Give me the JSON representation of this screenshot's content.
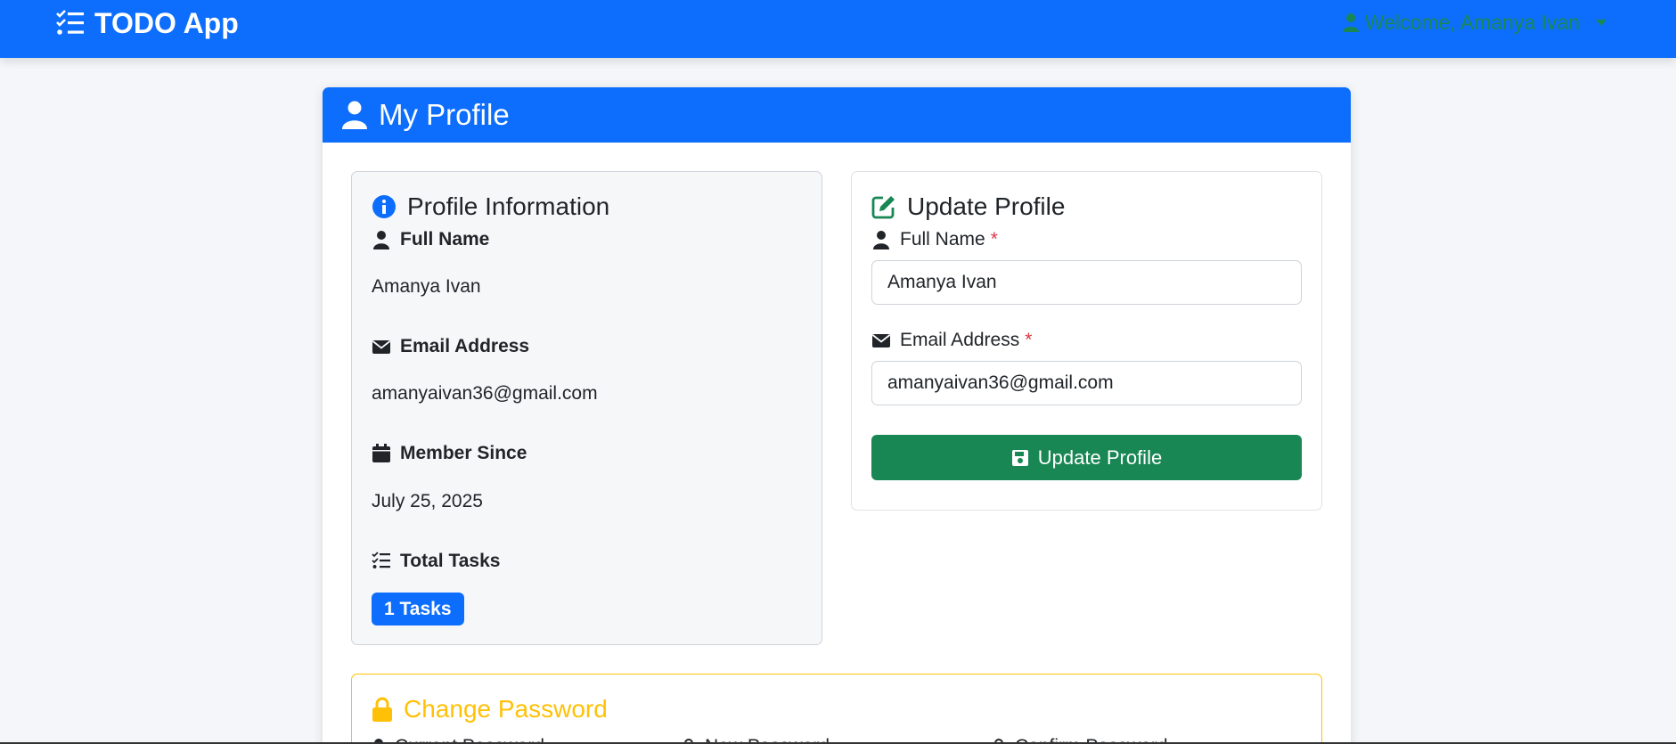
{
  "navbar": {
    "brand": "TODO App",
    "brand_icon": "tasks-list-icon",
    "user_greeting": "Welcome, Amanya Ivan",
    "user_icon": "user-icon"
  },
  "card": {
    "title": "My Profile",
    "title_icon": "user-icon"
  },
  "profile_info": {
    "title": "Profile Information",
    "full_name_label": "Full Name",
    "full_name_value": "Amanya Ivan",
    "email_label": "Email Address",
    "email_value": "amanyaivan36@gmail.com",
    "member_since_label": "Member Since",
    "member_since_value": "July 25, 2025",
    "total_tasks_label": "Total Tasks",
    "total_tasks_badge": "1 Tasks"
  },
  "update_profile": {
    "title": "Update Profile",
    "full_name_label": "Full Name",
    "full_name_value": "Amanya Ivan",
    "email_label": "Email Address",
    "email_value": "amanyaivan36@gmail.com",
    "required_mark": "*",
    "submit_label": "Update Profile"
  },
  "change_password": {
    "title": "Change Password",
    "current_label": "Current Password",
    "new_label": "New Password",
    "confirm_label": "Confirm Password"
  },
  "colors": {
    "primary": "#0d6efd",
    "success": "#198754",
    "warning": "#ffc107",
    "danger": "#dc3545"
  }
}
